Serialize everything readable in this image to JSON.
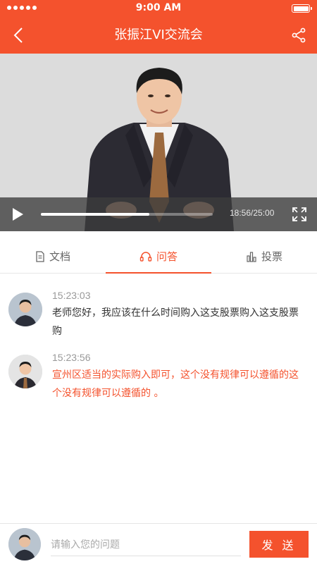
{
  "status_bar": {
    "time": "9:00 AM"
  },
  "nav": {
    "title": "张振江VI交流会",
    "back_icon": "chevron-left-icon",
    "share_icon": "share-icon"
  },
  "video": {
    "current_time": "18:56",
    "total_time": "25:00",
    "time_display": "18:56/25:00",
    "progress": 0.63
  },
  "tabs": [
    {
      "label": "文档",
      "icon": "document-icon",
      "active": false
    },
    {
      "label": "问答",
      "icon": "headset-icon",
      "active": true
    },
    {
      "label": "投票",
      "icon": "bar-chart-icon",
      "active": false
    }
  ],
  "messages": [
    {
      "time": "15:23:03",
      "text": "老师您好，我应该在什么时间购入这支股票购入这支股票购",
      "type": "question"
    },
    {
      "time": "15:23:56",
      "text": "宣州区适当的实际购入即可，这个没有规律可以遵循的这个没有规律可以遵循的 。",
      "type": "answer"
    }
  ],
  "input": {
    "placeholder": "请输入您的问题",
    "send_label": "发 送"
  },
  "colors": {
    "brand": "#f4522d",
    "text": "#333333",
    "muted": "#999999"
  }
}
